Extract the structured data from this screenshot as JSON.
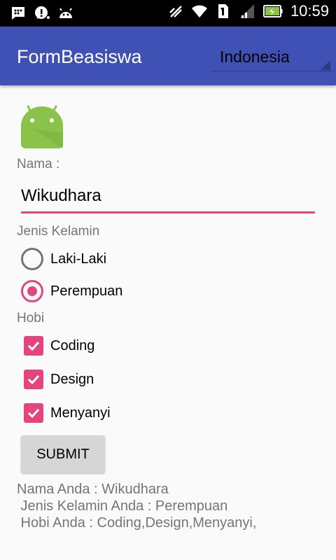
{
  "statusbar": {
    "left_icons": [
      "bbm-icon",
      "chat-alert-icon",
      "android-icon"
    ],
    "right_icons": [
      "mute-icon",
      "wifi-icon",
      "sim-1-icon",
      "signal-icon",
      "battery-charging-icon"
    ],
    "time": "10:59"
  },
  "appbar": {
    "title": "FormBeasiswa",
    "spinner_value": "Indonesia",
    "color": "#3f51b5"
  },
  "form": {
    "name_label": "Nama :",
    "name_value": "Wikudhara",
    "gender_label": "Jenis Kelamin",
    "gender_options": [
      {
        "label": "Laki-Laki",
        "checked": false
      },
      {
        "label": "Perempuan",
        "checked": true
      }
    ],
    "hobby_label": "Hobi",
    "hobbies": [
      {
        "label": "Coding",
        "checked": true
      },
      {
        "label": "Design",
        "checked": true
      },
      {
        "label": "Menyanyi",
        "checked": true
      }
    ],
    "submit_label": "SUBMIT",
    "accent": "#e3457d"
  },
  "result": {
    "line1": "Nama Anda : Wikudhara",
    "line2": " Jenis Kelamin Anda : Perempuan",
    "line3": " Hobi Anda : Coding,Design,Menyanyi,"
  }
}
